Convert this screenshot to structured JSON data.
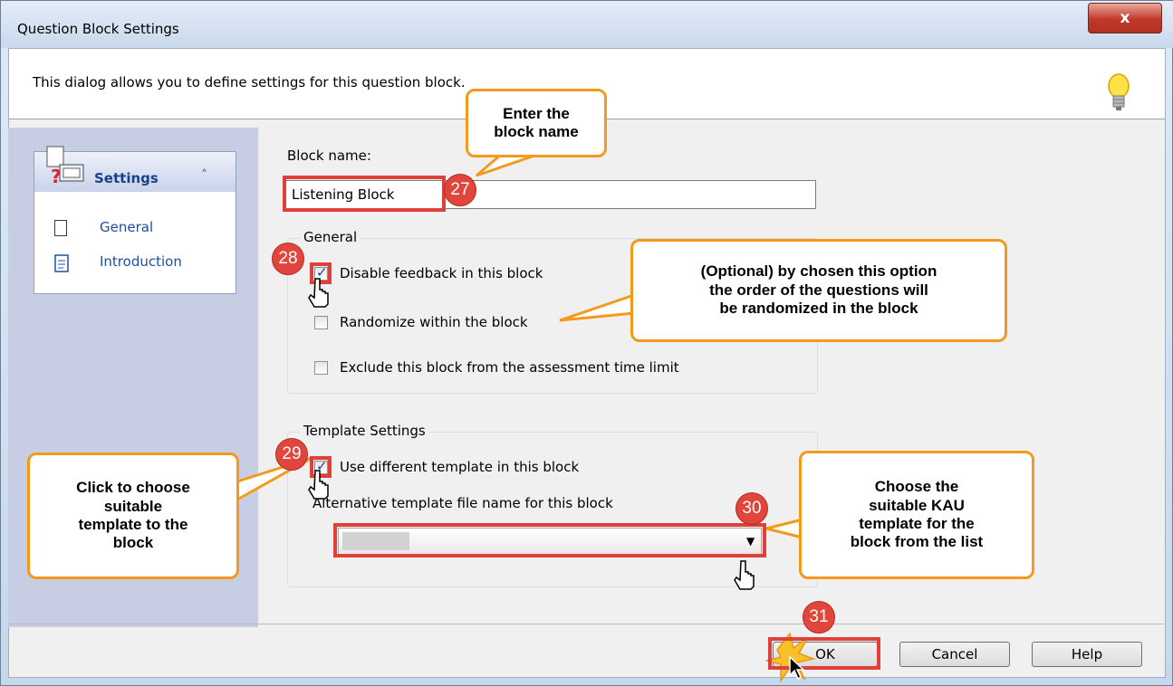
{
  "window": {
    "title": "Question Block Settings",
    "close_glyph": "x"
  },
  "description": "This dialog allows you to define settings for this question block.",
  "icons": {
    "help": "lightbulb-icon",
    "settings": "settings-icon",
    "general": "document-icon",
    "introduction": "document-lines-icon",
    "collapse": "chevron-up-double-icon",
    "cursor": "hand-pointer-icon"
  },
  "nav": {
    "header": "Settings",
    "collapse_glyph": "˄",
    "items": [
      {
        "label": "General"
      },
      {
        "label": "Introduction"
      }
    ]
  },
  "block_name": {
    "label": "Block name:",
    "value": "Listening Block"
  },
  "general_group": {
    "title": "General",
    "options": [
      {
        "label": "Disable feedback in this block",
        "checked": true
      },
      {
        "label": "Randomize within the block",
        "checked": false
      },
      {
        "label": "Exclude this block from the assessment time limit",
        "checked": false
      }
    ]
  },
  "template_group": {
    "title": "Template Settings",
    "use_different": {
      "label": "Use different template in this block",
      "checked": true
    },
    "alt_label": "Alternative template file name for this block",
    "select_value": ""
  },
  "buttons": {
    "ok": "OK",
    "cancel": "Cancel",
    "help": "Help"
  },
  "annotations": {
    "callouts": {
      "block_name": "Enter the\nblock name",
      "optional": "(Optional) by chosen this option\nthe order of the questions will\nbe randomized in the block",
      "choose_template": "Click to choose\nsuitable\ntemplate to the\nblock",
      "kau_template": "Choose the\nsuitable KAU\ntemplate for the\nblock from the list"
    },
    "steps": [
      "27",
      "28",
      "29",
      "30",
      "31"
    ],
    "colors": {
      "callout_border": "#f39a1c",
      "badge": "#e1463c",
      "highlight": "#e0403a"
    }
  }
}
